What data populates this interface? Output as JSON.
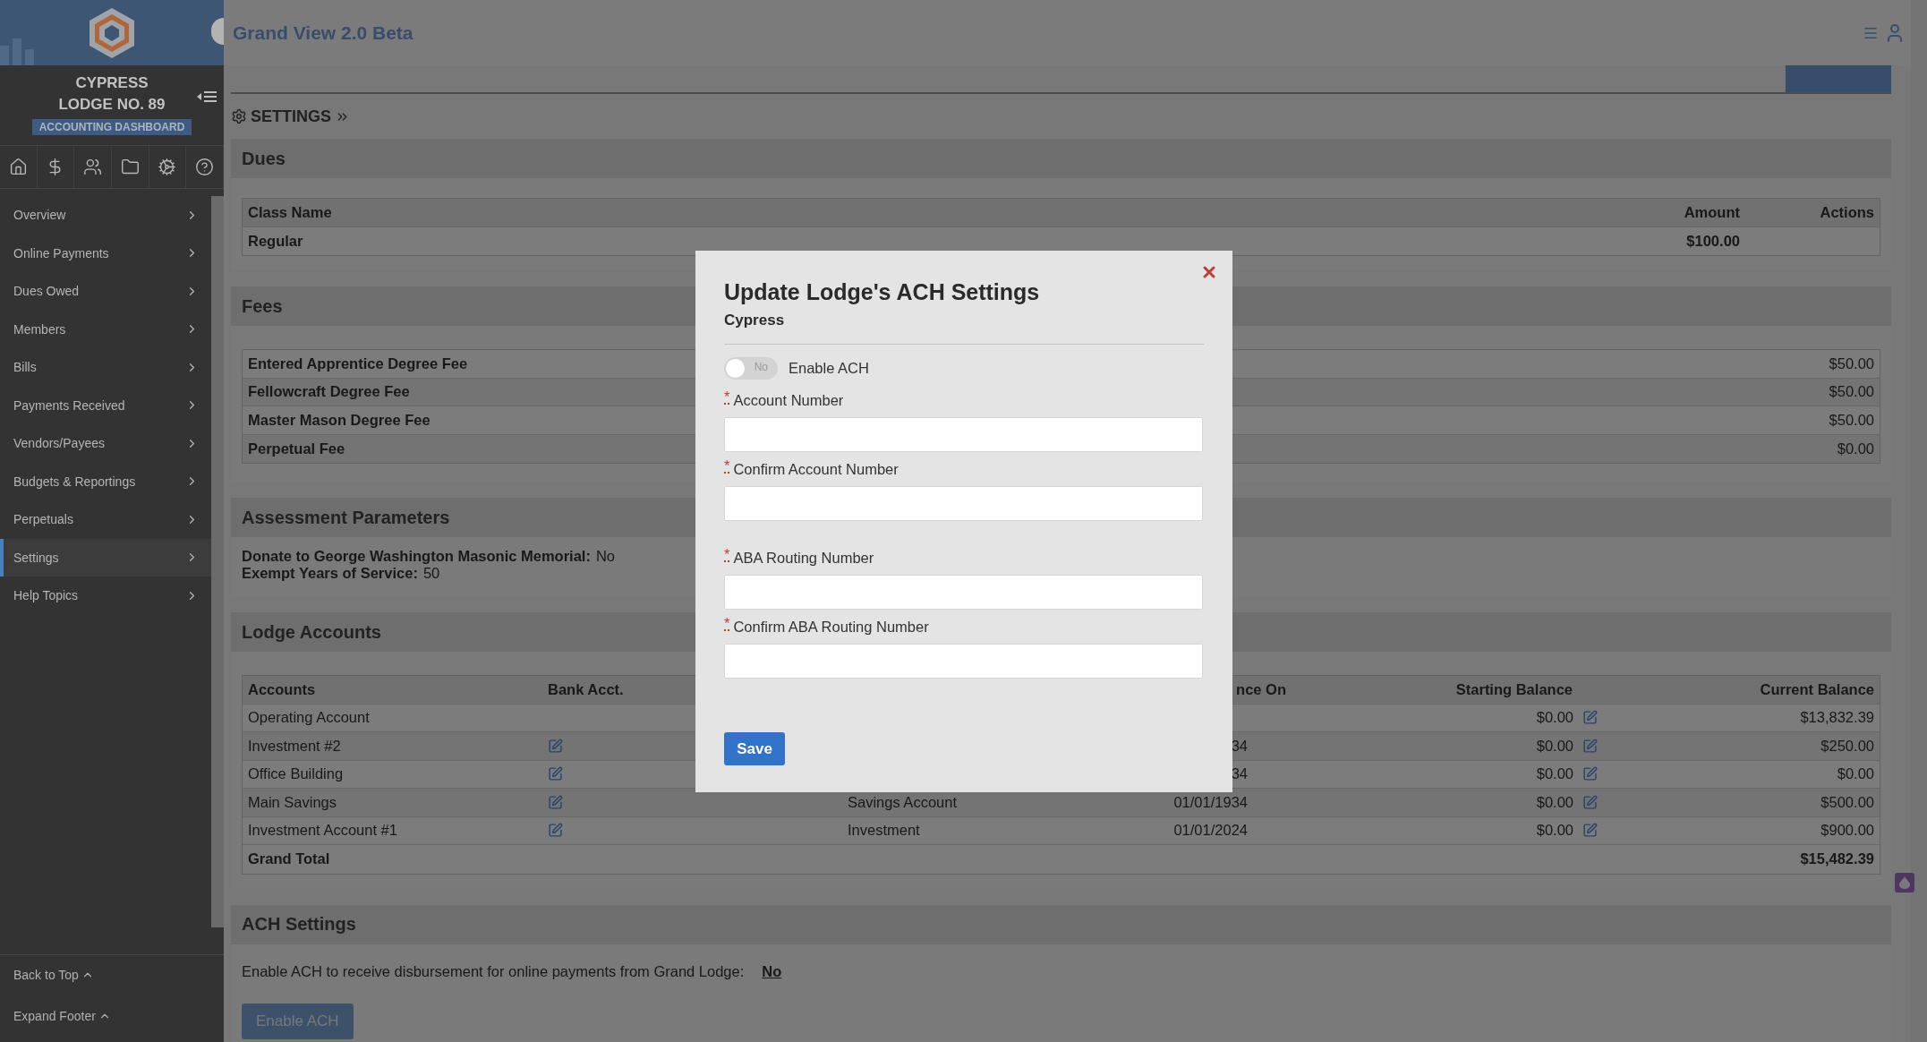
{
  "app": {
    "title": "Grand View 2.0 Beta"
  },
  "sidebar": {
    "lodge_name": "CYPRESS",
    "lodge_number": "LODGE NO. 89",
    "badge": "ACCOUNTING DASHBOARD",
    "items": [
      {
        "label": "Overview",
        "selected": false
      },
      {
        "label": "Online Payments",
        "selected": false
      },
      {
        "label": "Dues Owed",
        "selected": false
      },
      {
        "label": "Members",
        "selected": false
      },
      {
        "label": "Bills",
        "selected": false
      },
      {
        "label": "Payments Received",
        "selected": false
      },
      {
        "label": "Vendors/Payees",
        "selected": false
      },
      {
        "label": "Budgets & Reportings",
        "selected": false
      },
      {
        "label": "Perpetuals",
        "selected": false
      },
      {
        "label": "Settings",
        "selected": true
      },
      {
        "label": "Help Topics",
        "selected": false
      }
    ],
    "footer_links": [
      "Back to Top",
      "Expand Footer"
    ]
  },
  "breadcrumb": "SETTINGS",
  "dues": {
    "title": "Dues",
    "columns": [
      "Class Name",
      "Amount",
      "Actions"
    ],
    "rows": [
      {
        "class_name": "Regular",
        "amount": "$100.00"
      }
    ]
  },
  "fees": {
    "title": "Fees",
    "rows": [
      {
        "name": "Entered Apprentice Degree Fee",
        "amount": "$50.00"
      },
      {
        "name": "Fellowcraft Degree Fee",
        "amount": "$50.00"
      },
      {
        "name": "Master Mason Degree Fee",
        "amount": "$50.00"
      },
      {
        "name": "Perpetual Fee",
        "amount": "$0.00"
      }
    ]
  },
  "assessment": {
    "title": "Assessment Parameters",
    "items": [
      {
        "label": "Donate to George Washington Masonic Memorial:",
        "value": "No"
      },
      {
        "label": "Exempt Years of Service:",
        "value": "50"
      }
    ]
  },
  "lodge_accounts": {
    "title": "Lodge Accounts",
    "columns": [
      "Accounts",
      "Bank Acct.",
      null,
      "nce On",
      "Starting Balance",
      "Current Balance"
    ],
    "rows": [
      {
        "account": "Operating Account",
        "bank_editable": false,
        "starting_balance": "$0.00",
        "current_balance": "$13,832.39"
      },
      {
        "account": "Investment #2",
        "bank_editable": true,
        "start_on": "34",
        "starting_balance": "$0.00",
        "current_balance": "$250.00"
      },
      {
        "account": "Office Building",
        "bank_editable": true,
        "start_on": "34",
        "starting_balance": "$0.00",
        "current_balance": "$0.00"
      },
      {
        "account": "Main Savings",
        "bank_editable": true,
        "type": "Savings Account",
        "start_on": "01/01/1934",
        "starting_balance": "$0.00",
        "current_balance": "$500.00"
      },
      {
        "account": "Investment Account #1",
        "bank_editable": true,
        "type": "Investment",
        "start_on": "01/01/2024",
        "starting_balance": "$0.00",
        "current_balance": "$900.00"
      }
    ],
    "total": {
      "label": "Grand Total",
      "value": "$15,482.39"
    }
  },
  "ach": {
    "title": "ACH Settings",
    "text": "Enable ACH to receive disbursement for online payments from Grand Lodge:",
    "status": "No",
    "button": "Enable ACH"
  },
  "modal": {
    "title": "Update Lodge's ACH Settings",
    "subtitle": "Cypress",
    "toggle": {
      "label": "Enable ACH",
      "on": false,
      "state_text": "No"
    },
    "required_mark": "*",
    "field_groups": [
      {
        "fields": [
          {
            "label": "Account Number",
            "required": true
          },
          {
            "label": "Confirm Account Number",
            "required": true
          }
        ]
      },
      {
        "fields": [
          {
            "label": "ABA Routing Number",
            "required": true
          },
          {
            "label": "Confirm ABA Routing Number",
            "required": true
          }
        ]
      }
    ],
    "save": "Save"
  }
}
